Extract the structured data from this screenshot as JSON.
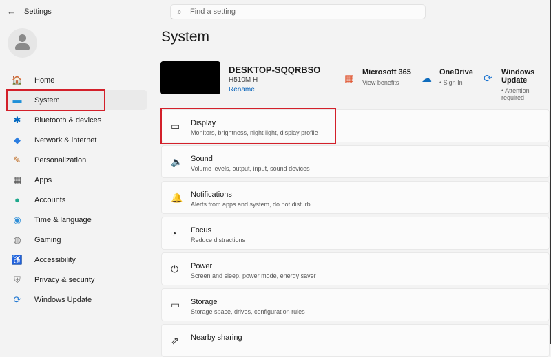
{
  "titlebar": {
    "title": "Settings",
    "search_placeholder": "Find a setting"
  },
  "sidebar": {
    "items": [
      {
        "label": "Home",
        "icon": "home-icon",
        "glyph": "🏠",
        "color": "#d9822b"
      },
      {
        "label": "System",
        "icon": "monitor-icon",
        "glyph": "▬",
        "color": "#1e90d8"
      },
      {
        "label": "Bluetooth & devices",
        "icon": "bluetooth-icon",
        "glyph": "✱",
        "color": "#0067c0"
      },
      {
        "label": "Network & internet",
        "icon": "wifi-icon",
        "glyph": "◆",
        "color": "#2b7de0"
      },
      {
        "label": "Personalization",
        "icon": "brush-icon",
        "glyph": "✎",
        "color": "#c0702a"
      },
      {
        "label": "Apps",
        "icon": "apps-icon",
        "glyph": "▦",
        "color": "#555"
      },
      {
        "label": "Accounts",
        "icon": "accounts-icon",
        "glyph": "●",
        "color": "#1ea88c"
      },
      {
        "label": "Time & language",
        "icon": "globe-icon",
        "glyph": "◉",
        "color": "#2f8fd8"
      },
      {
        "label": "Gaming",
        "icon": "gamepad-icon",
        "glyph": "◍",
        "color": "#777"
      },
      {
        "label": "Accessibility",
        "icon": "accessibility-icon",
        "glyph": "♿",
        "color": "#1a6fc4"
      },
      {
        "label": "Privacy & security",
        "icon": "shield-icon",
        "glyph": "⛨",
        "color": "#777"
      },
      {
        "label": "Windows Update",
        "icon": "update-icon",
        "glyph": "⟳",
        "color": "#1a73d0"
      }
    ]
  },
  "main": {
    "title": "System",
    "device": {
      "name": "DESKTOP-SQQRBSO",
      "model": "H510M H",
      "rename": "Rename"
    },
    "services": [
      {
        "title": "Microsoft 365",
        "sub": "View benefits",
        "glyph": "▦",
        "color": "#e0502a"
      },
      {
        "title": "OneDrive",
        "sub": "• Sign In",
        "glyph": "☁",
        "color": "#0f6cbd"
      },
      {
        "title": "Windows Update",
        "sub": "• Attention required",
        "glyph": "⟳",
        "color": "#1a73d0"
      }
    ],
    "cards": [
      {
        "title": "Display",
        "sub": "Monitors, brightness, night light, display profile",
        "glyph": "▭",
        "icon": "display-icon"
      },
      {
        "title": "Sound",
        "sub": "Volume levels, output, input, sound devices",
        "glyph": "🔈",
        "icon": "sound-icon"
      },
      {
        "title": "Notifications",
        "sub": "Alerts from apps and system, do not disturb",
        "glyph": "🔔",
        "icon": "bell-icon"
      },
      {
        "title": "Focus",
        "sub": "Reduce distractions",
        "glyph": "◔",
        "icon": "focus-icon"
      },
      {
        "title": "Power",
        "sub": "Screen and sleep, power mode, energy saver",
        "glyph": "⏻",
        "icon": "power-icon"
      },
      {
        "title": "Storage",
        "sub": "Storage space, drives, configuration rules",
        "glyph": "▭",
        "icon": "storage-icon"
      },
      {
        "title": "Nearby sharing",
        "sub": "",
        "glyph": "⇗",
        "icon": "share-icon"
      }
    ]
  }
}
